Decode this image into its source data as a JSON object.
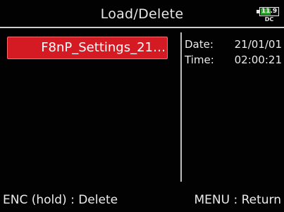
{
  "title": "Load/Delete",
  "battery": {
    "voltage": "11.9",
    "source": "DC",
    "level": 0.55,
    "fill_color": "#2fa52f"
  },
  "file_list": {
    "items": [
      {
        "label": "F8nP_Settings_21…",
        "selected": true
      }
    ],
    "selected_color": "#d41a22"
  },
  "info": {
    "date_label": "Date:",
    "date_value": "21/01/01",
    "time_label": "Time:",
    "time_value": "02:00:21"
  },
  "footer": {
    "left_hint": "ENC (hold) : Delete",
    "right_hint": "MENU : Return"
  }
}
